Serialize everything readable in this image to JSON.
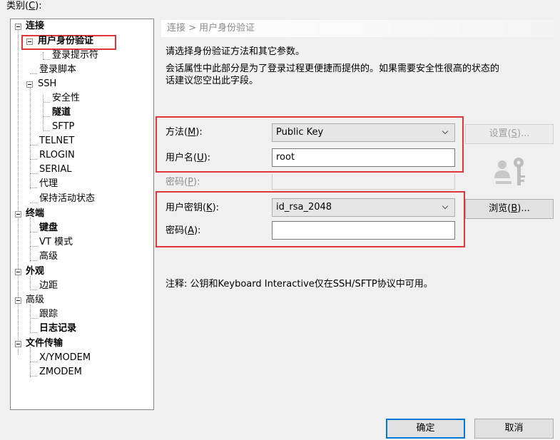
{
  "category": {
    "label": "类别(",
    "hotkey": "C",
    "end": "):"
  },
  "tree": {
    "connection": "连接",
    "auth": "用户身份验证",
    "login_prompts": "登录提示符",
    "login_script": "登录脚本",
    "ssh": "SSH",
    "security": "安全性",
    "tunneling": "隧道",
    "sftp": "SFTP",
    "telnet": "TELNET",
    "rlogin": "RLOGIN",
    "serial": "SERIAL",
    "proxy": "代理",
    "keep_alive": "保持活动状态",
    "terminal": "终端",
    "keyboard": "键盘",
    "vt_modes": "VT 模式",
    "advanced": "高级",
    "appearance": "外观",
    "margins": "边距",
    "advanced2": "高级",
    "trace": "跟踪",
    "logging": "日志记录",
    "file_transfer": "文件传输",
    "xymodem": "X/YMODEM",
    "zmodem": "ZMODEM"
  },
  "header": {
    "breadcrumb": "连接 > 用户身份验证"
  },
  "intro": {
    "line1": "请选择身份验证方法和其它参数。",
    "line2": "会话属性中此部分是为了登录过程更便捷而提供的。如果需要安全性很高的状态的",
    "line3": "话建议您空出此字段。"
  },
  "form": {
    "method_label": {
      "pre": "方法(",
      "key": "M",
      "post": "):"
    },
    "method_value": "Public Key",
    "username_label": {
      "pre": "用户名(",
      "key": "U",
      "post": "):"
    },
    "username_value": "root",
    "password_label": {
      "pre": "密码(",
      "key": "P",
      "post": "):"
    },
    "settings_button": {
      "pre": "设置(",
      "key": "S",
      "post": ")..."
    },
    "userkey_label": {
      "pre": "用户密钥(",
      "key": "K",
      "post": "):"
    },
    "userkey_value": "id_rsa_2048",
    "passphrase_label": {
      "pre": "密码(",
      "key": "A",
      "post": "):"
    },
    "passphrase_value": "",
    "browse_button": {
      "pre": "浏览(",
      "key": "B",
      "post": ")..."
    }
  },
  "note": "注释: 公钥和Keyboard Interactive仅在SSH/SFTP协议中可用。",
  "footer": {
    "ok": "确定",
    "cancel": "取消"
  },
  "icons": {
    "user_key": "user-key-icon",
    "dropdown": "chevron-down-icon"
  },
  "colors": {
    "highlight_border": "#e0353a",
    "default_button_border": "#0078d7"
  }
}
